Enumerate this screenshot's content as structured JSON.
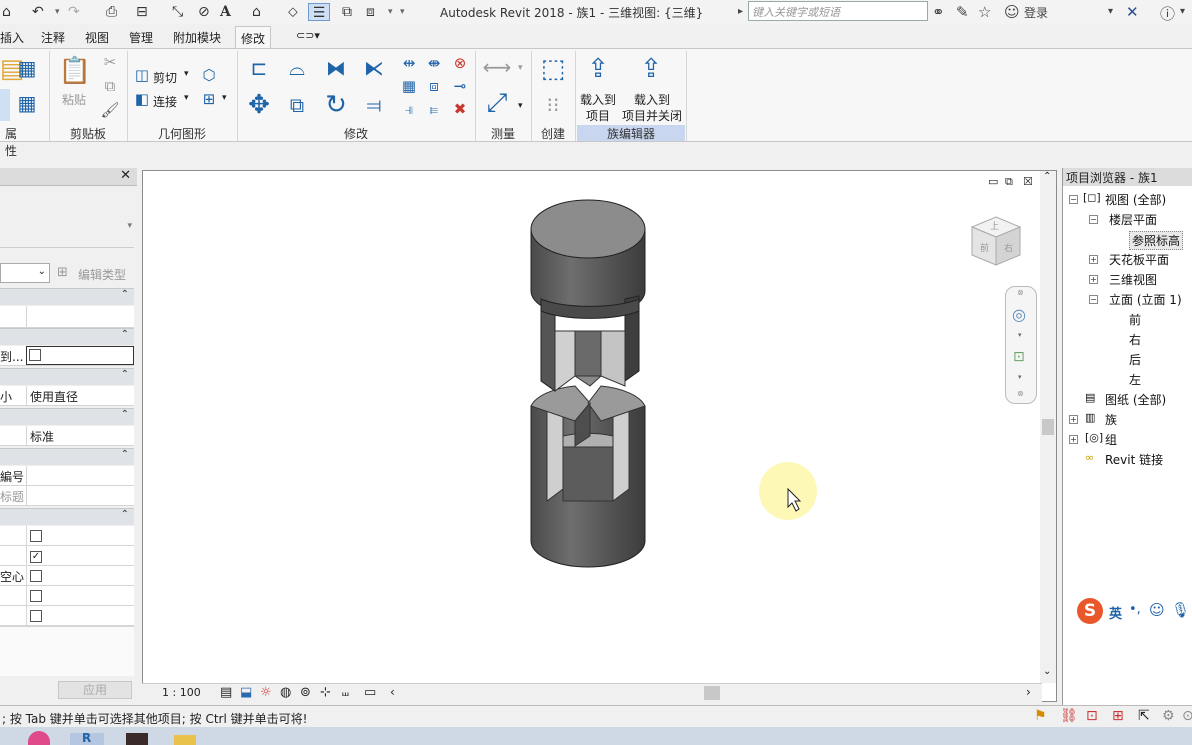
{
  "window": {
    "title": "Autodesk Revit 2018 -    族1 - 三维视图: {三维}",
    "search_placeholder": "键入关键字或短语",
    "login": "登录"
  },
  "tabs": [
    {
      "label": "插入"
    },
    {
      "label": "注释"
    },
    {
      "label": "视图"
    },
    {
      "label": "管理"
    },
    {
      "label": "附加模块"
    },
    {
      "label": "修改",
      "active": true
    }
  ],
  "ribbon": {
    "panels": [
      "属性",
      "剪贴板",
      "几何图形",
      "修改",
      "测量",
      "创建",
      "族编辑器"
    ],
    "paste_label": "粘贴",
    "cut_label": "剪切",
    "join_label": "连接",
    "load_project": [
      "载入到",
      "项目"
    ],
    "load_close": [
      "载入到",
      "项目并关闭"
    ]
  },
  "properties": {
    "edit_type": "编辑类型",
    "rows": [
      {
        "label": "到...",
        "value": "",
        "checkbox": "empty"
      },
      {
        "label": "小",
        "value": "使用直径"
      },
      {
        "label": "",
        "value": "标准"
      },
      {
        "label": "編号",
        "value": ""
      },
      {
        "label": "标题",
        "value": ""
      },
      {
        "label": "",
        "checkbox": "empty"
      },
      {
        "label": "",
        "checkbox": "checked"
      },
      {
        "label": "空心",
        "checkbox": "empty"
      },
      {
        "label": "",
        "checkbox": "empty"
      },
      {
        "label": "",
        "checkbox": "empty"
      }
    ],
    "apply": "应用"
  },
  "view": {
    "scale": "1 : 100",
    "viewcube_top": "上",
    "viewcube_front": "前",
    "viewcube_right": "右"
  },
  "browser": {
    "title": "项目浏览器 - 族1",
    "nodes": [
      {
        "label": "视图 (全部)"
      },
      {
        "label": "楼层平面"
      },
      {
        "label": "参照标高",
        "selected": true
      },
      {
        "label": "天花板平面"
      },
      {
        "label": "三维视图"
      },
      {
        "label": "立面 (立面 1)"
      },
      {
        "label": "前"
      },
      {
        "label": "右"
      },
      {
        "label": "后"
      },
      {
        "label": "左"
      },
      {
        "label": "图纸 (全部)"
      },
      {
        "label": "族"
      },
      {
        "label": "组"
      },
      {
        "label": "Revit 链接"
      }
    ]
  },
  "ime": {
    "label": "英"
  },
  "status": {
    "text": "; 按 Tab 键并单击可选择其他项目; 按 Ctrl 键并单击可将!"
  },
  "colors": {
    "accent": "#1f63a8",
    "selected_tab_band": "#c9d6ef",
    "highlight": "#fdf7a8"
  }
}
